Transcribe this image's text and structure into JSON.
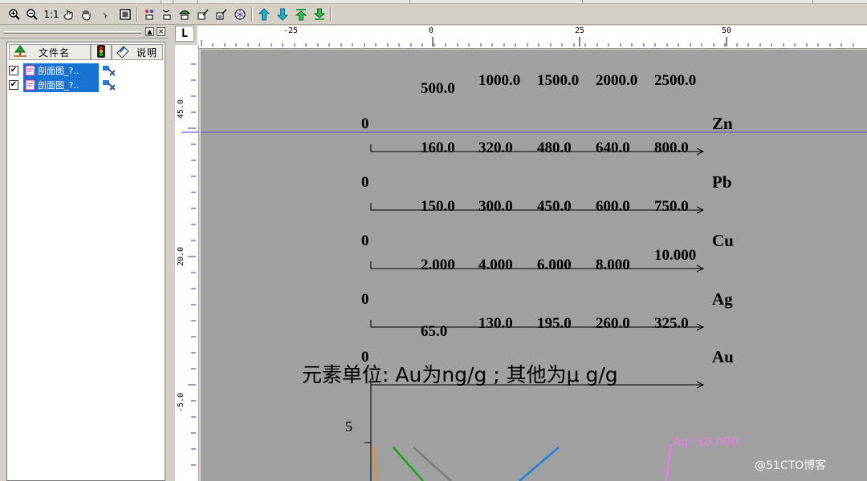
{
  "toolbar": {
    "zoom_reset_label": "1:1"
  },
  "left_panel": {
    "col_filename": "文件名",
    "col_description": "说明",
    "rows": [
      {
        "name": "剖面图_?..",
        "checked": true
      },
      {
        "name": "剖面图_?..",
        "checked": true
      }
    ]
  },
  "ruler": {
    "h_ticks": [
      "-25",
      "0",
      "25",
      "50"
    ],
    "v_ticks": [
      "45.0",
      "20.0",
      "-5.0"
    ]
  },
  "corner_label": "L",
  "chart": {
    "zero_label": "0",
    "rows": [
      {
        "element": "Zn",
        "tick_labels": [
          "500.0",
          "1000.0",
          "1500.0",
          "2000.0",
          "2500.0"
        ]
      },
      {
        "element": "Pb",
        "tick_labels": [
          "160.0",
          "320.0",
          "480.0",
          "640.0",
          "800.0"
        ]
      },
      {
        "element": "Cu",
        "tick_labels": [
          "150.0",
          "300.0",
          "450.0",
          "600.0",
          "750.0"
        ]
      },
      {
        "element": "Ag",
        "tick_labels": [
          "2.000",
          "4.000",
          "6.000",
          "8.000",
          "10.000"
        ]
      },
      {
        "element": "Au",
        "tick_labels": [
          "65.0",
          "130.0",
          "195.0",
          "260.0",
          "325.0"
        ]
      }
    ],
    "unit_note": "元素单位:  Au为ng/g  ;  其他为μ g/g",
    "lower_axis_label": "5",
    "ag_series_label": "Ag: 10.000",
    "series_colors": {
      "orange": "#e8901e",
      "green": "#1aa01a",
      "gray": "#7a7a7a",
      "blue": "#1e7ee8",
      "pink": "#e87be8"
    }
  },
  "watermark": "@51CTO博客"
}
